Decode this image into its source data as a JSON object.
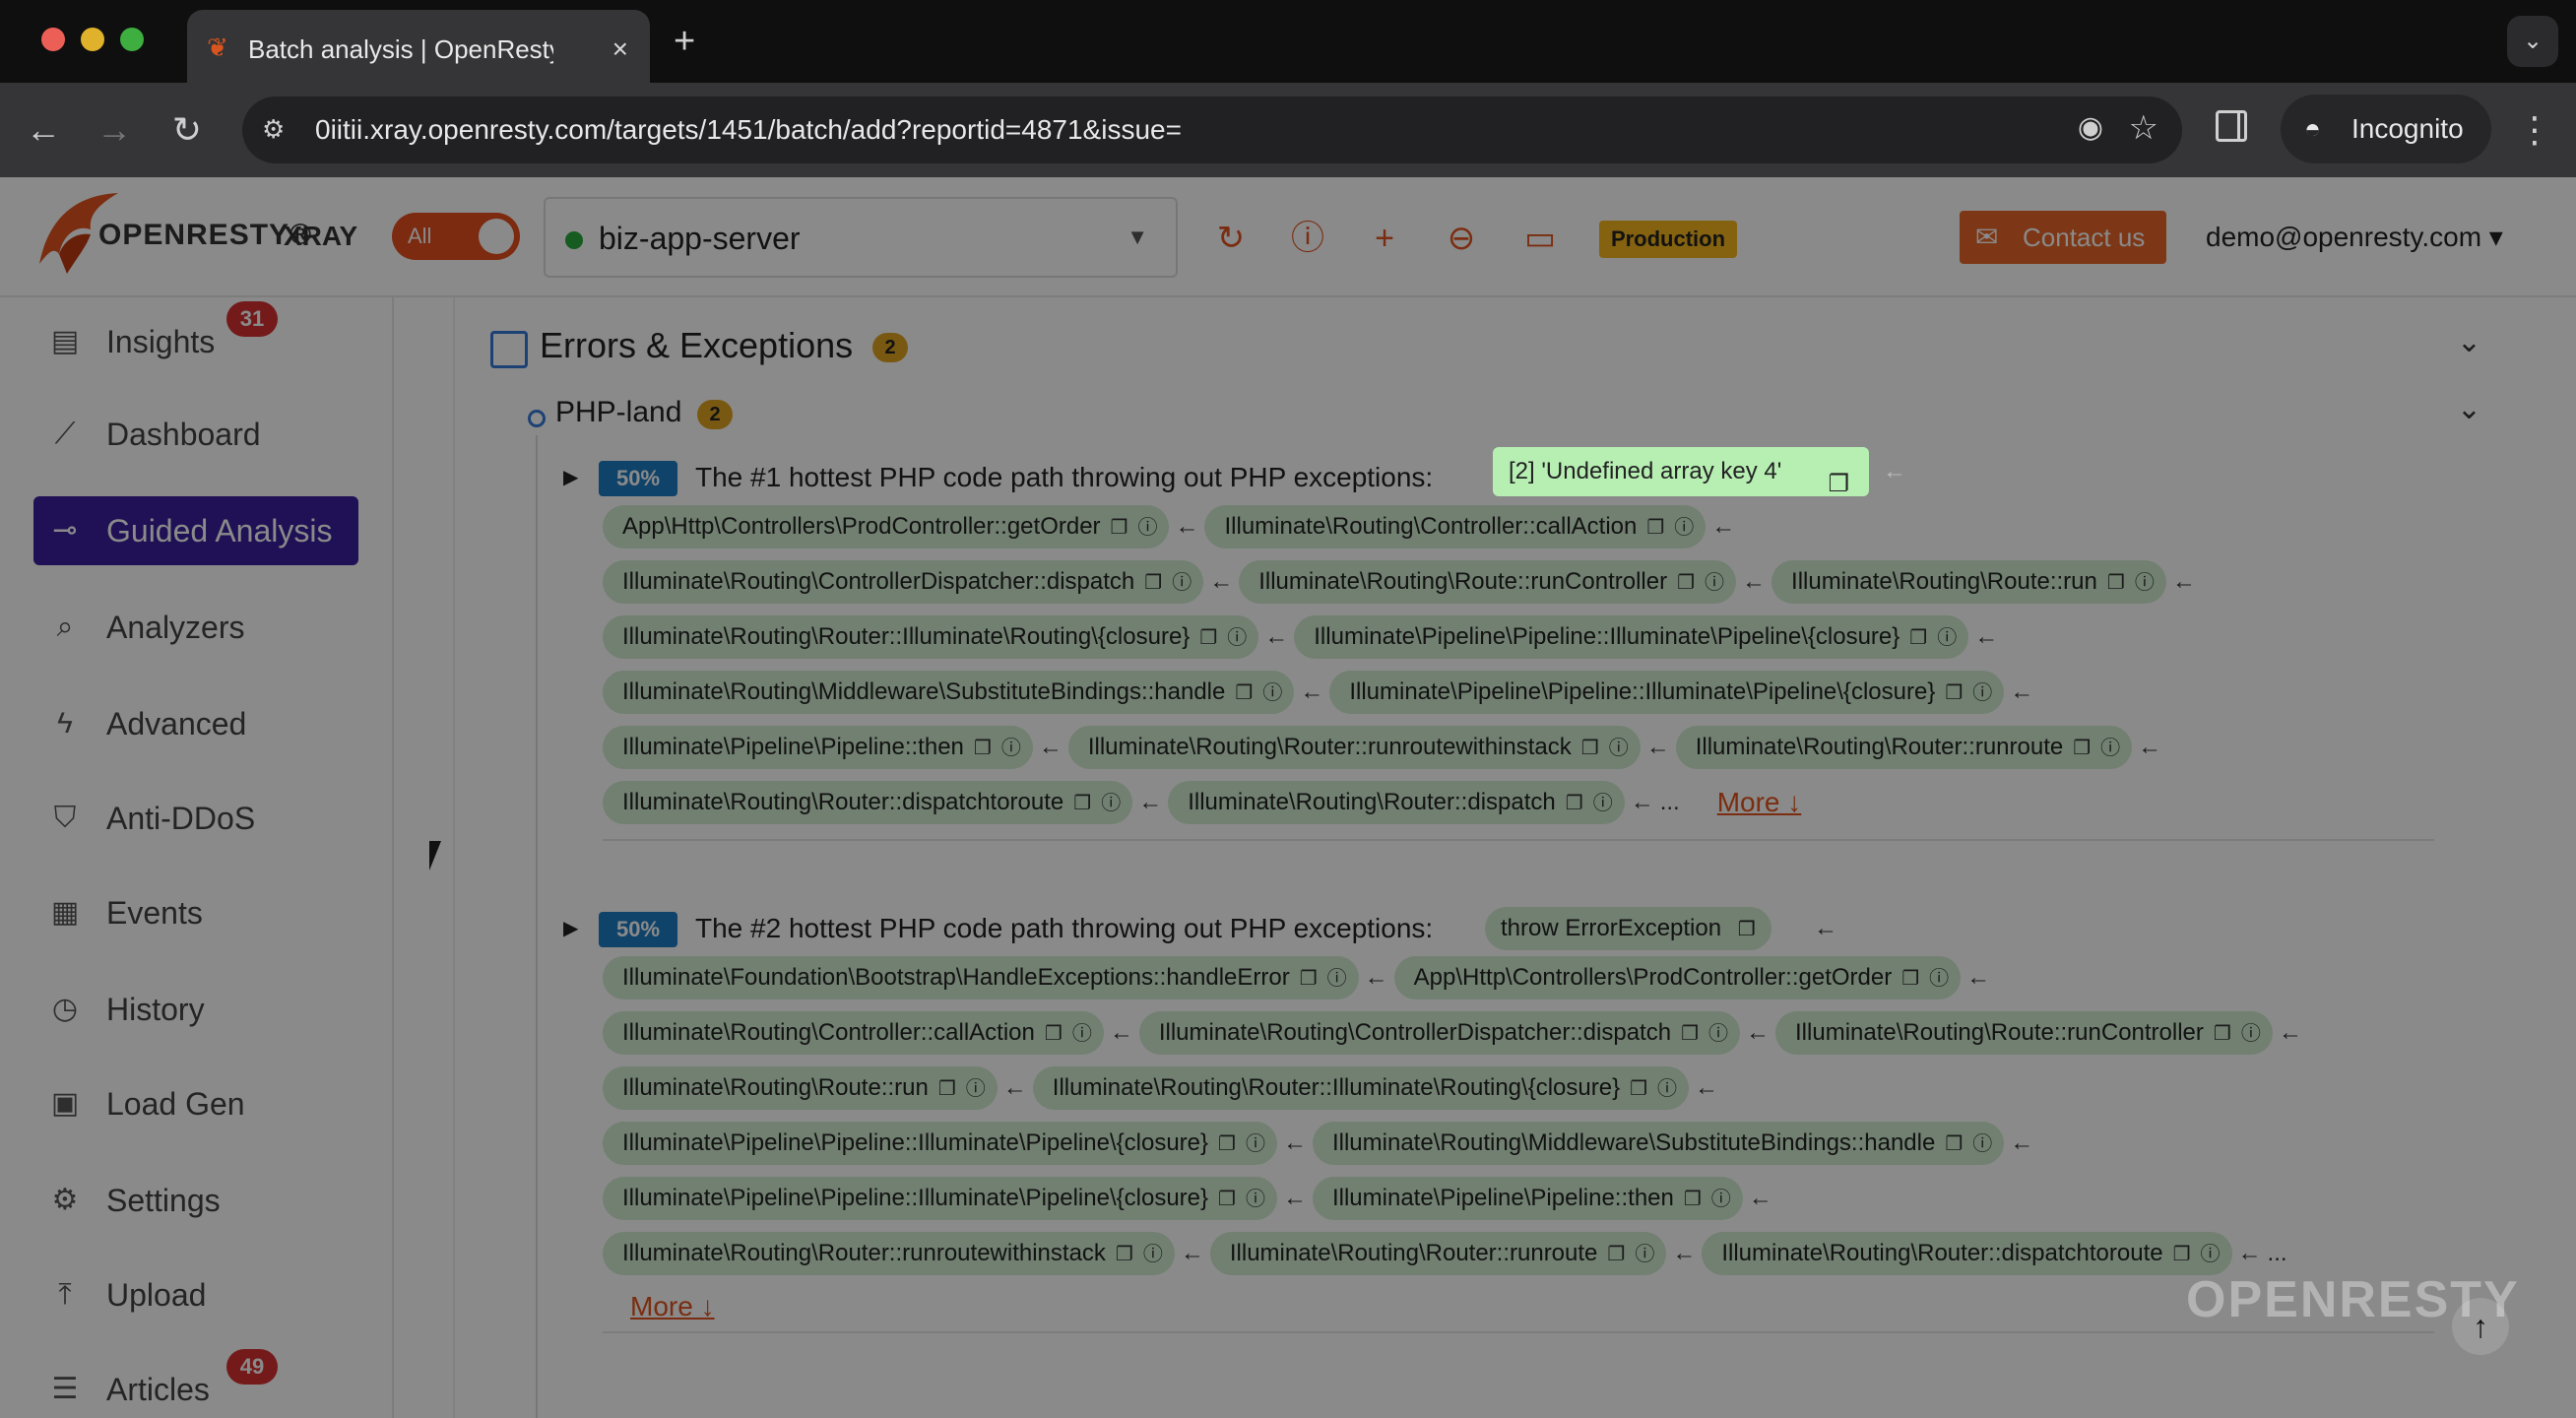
{
  "browser": {
    "tab_title": "Batch analysis | OpenResty X",
    "new_tab": "+",
    "tab_close": "×",
    "url": "0iitii.xray.openresty.com/targets/1451/batch/add?reportid=4871&issue=",
    "incognito_label": "Incognito"
  },
  "header": {
    "logo_text": "OPENRESTY®",
    "logo_xray": "XRAY",
    "toggle_label": "All",
    "target": "biz-app-server",
    "env_badge": "Production",
    "contact_label": "Contact us",
    "user": "demo@openresty.com ▾"
  },
  "sidebar": {
    "items": [
      {
        "label": "Insights",
        "icon": "document-icon",
        "badge": "31"
      },
      {
        "label": "Dashboard",
        "icon": "chart-line-icon"
      },
      {
        "label": "Guided Analysis",
        "icon": "key-icon",
        "active": true
      },
      {
        "label": "Analyzers",
        "icon": "search-icon"
      },
      {
        "label": "Advanced",
        "icon": "bolt-icon"
      },
      {
        "label": "Anti-DDoS",
        "icon": "shield-icon"
      },
      {
        "label": "Events",
        "icon": "calendar-icon"
      },
      {
        "label": "History",
        "icon": "clock-icon"
      },
      {
        "label": "Load Gen",
        "icon": "load-gen-icon"
      },
      {
        "label": "Settings",
        "icon": "gear-icon"
      },
      {
        "label": "Upload",
        "icon": "upload-icon"
      },
      {
        "label": "Articles",
        "icon": "articles-icon",
        "badge": "49"
      }
    ]
  },
  "section": {
    "title": "Errors & Exceptions",
    "count": "2",
    "sub_title": "PHP-land",
    "sub_count": "2"
  },
  "paths": [
    {
      "percent": "50%",
      "text": "The #1 hottest PHP code path throwing out PHP exceptions:",
      "exception": "[2] 'Undefined array key 4'",
      "more": "More ↓",
      "ellipsis": "...",
      "rows": [
        [
          "App\\Http\\Controllers\\ProdController::getOrder",
          "Illuminate\\Routing\\Controller::callAction"
        ],
        [
          "Illuminate\\Routing\\ControllerDispatcher::dispatch",
          "Illuminate\\Routing\\Route::runController",
          "Illuminate\\Routing\\Route::run"
        ],
        [
          "Illuminate\\Routing\\Router::Illuminate\\Routing\\{closure}",
          "Illuminate\\Pipeline\\Pipeline::Illuminate\\Pipeline\\{closure}"
        ],
        [
          "Illuminate\\Routing\\Middleware\\SubstituteBindings::handle",
          "Illuminate\\Pipeline\\Pipeline::Illuminate\\Pipeline\\{closure}"
        ],
        [
          "Illuminate\\Pipeline\\Pipeline::then",
          "Illuminate\\Routing\\Router::runroutewithinstack",
          "Illuminate\\Routing\\Router::runroute"
        ],
        [
          "Illuminate\\Routing\\Router::dispatchtoroute",
          "Illuminate\\Routing\\Router::dispatch"
        ]
      ]
    },
    {
      "percent": "50%",
      "text": "The #2 hottest PHP code path throwing out PHP exceptions:",
      "exception": "throw ErrorException",
      "more": "More ↓",
      "ellipsis": "...",
      "rows": [
        [
          "Illuminate\\Foundation\\Bootstrap\\HandleExceptions::handleError",
          "App\\Http\\Controllers\\ProdController::getOrder"
        ],
        [
          "Illuminate\\Routing\\Controller::callAction",
          "Illuminate\\Routing\\ControllerDispatcher::dispatch",
          "Illuminate\\Routing\\Route::runController"
        ],
        [
          "Illuminate\\Routing\\Route::run",
          "Illuminate\\Routing\\Router::Illuminate\\Routing\\{closure}"
        ],
        [
          "Illuminate\\Pipeline\\Pipeline::Illuminate\\Pipeline\\{closure}",
          "Illuminate\\Routing\\Middleware\\SubstituteBindings::handle"
        ],
        [
          "Illuminate\\Pipeline\\Pipeline::Illuminate\\Pipeline\\{closure}",
          "Illuminate\\Pipeline\\Pipeline::then"
        ],
        [
          "Illuminate\\Routing\\Router::runroutewithinstack",
          "Illuminate\\Routing\\Router::runroute",
          "Illuminate\\Routing\\Router::dispatchtoroute"
        ]
      ]
    }
  ],
  "watermark": "OPENRESTY",
  "colors": {
    "brand_orange": "#e2541e",
    "active_nav": "#3b1e9e",
    "frame_green": "#d1ecd1",
    "percent_blue": "#1f7cc2",
    "badge_yellow": "#e0a522",
    "badge_red": "#d63030"
  }
}
